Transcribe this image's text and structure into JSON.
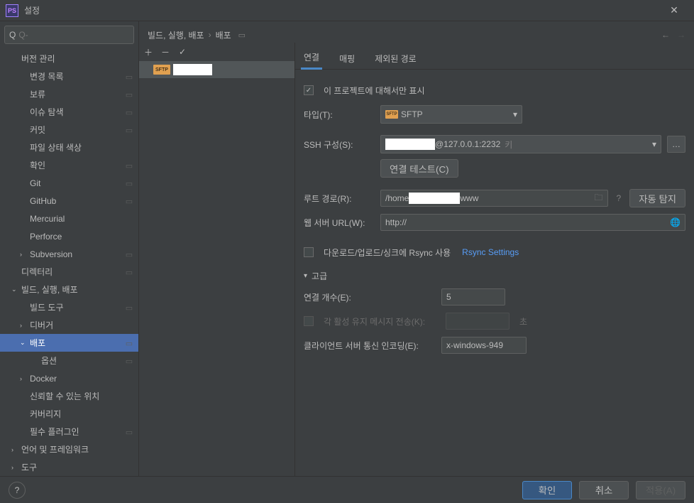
{
  "window": {
    "title": "설정",
    "logo": "PS"
  },
  "search": {
    "placeholder": "Q-"
  },
  "sidebar": {
    "items": [
      {
        "label": "버전 관리",
        "depth": 0,
        "expand": "",
        "ind": false
      },
      {
        "label": "변경 목록",
        "depth": 1,
        "expand": "",
        "ind": true
      },
      {
        "label": "보류",
        "depth": 1,
        "expand": "",
        "ind": true
      },
      {
        "label": "이슈 탐색",
        "depth": 1,
        "expand": "",
        "ind": true
      },
      {
        "label": "커밋",
        "depth": 1,
        "expand": "",
        "ind": true
      },
      {
        "label": "파일 상태 색상",
        "depth": 1,
        "expand": "",
        "ind": false
      },
      {
        "label": "확인",
        "depth": 1,
        "expand": "",
        "ind": true
      },
      {
        "label": "Git",
        "depth": 1,
        "expand": "",
        "ind": true
      },
      {
        "label": "GitHub",
        "depth": 1,
        "expand": "",
        "ind": true
      },
      {
        "label": "Mercurial",
        "depth": 1,
        "expand": "",
        "ind": false
      },
      {
        "label": "Perforce",
        "depth": 1,
        "expand": "",
        "ind": false
      },
      {
        "label": "Subversion",
        "depth": 1,
        "expand": "›",
        "ind": true
      },
      {
        "label": "디렉터리",
        "depth": 0,
        "expand": "",
        "ind": true
      },
      {
        "label": "빌드, 실행, 배포",
        "depth": 0,
        "expand": "⌄",
        "ind": false
      },
      {
        "label": "빌드 도구",
        "depth": 1,
        "expand": "",
        "ind": true
      },
      {
        "label": "디버거",
        "depth": 1,
        "expand": "›",
        "ind": false
      },
      {
        "label": "배포",
        "depth": 1,
        "expand": "⌄",
        "ind": true,
        "selected": true
      },
      {
        "label": "옵션",
        "depth": 2,
        "expand": "",
        "ind": true
      },
      {
        "label": "Docker",
        "depth": 1,
        "expand": "›",
        "ind": false
      },
      {
        "label": "신뢰할 수 있는 위치",
        "depth": 1,
        "expand": "",
        "ind": false
      },
      {
        "label": "커버리지",
        "depth": 1,
        "expand": "",
        "ind": false
      },
      {
        "label": "필수 플러그인",
        "depth": 1,
        "expand": "",
        "ind": true
      },
      {
        "label": "언어 및 프레임워크",
        "depth": 0,
        "expand": "›",
        "ind": false
      },
      {
        "label": "도구",
        "depth": 0,
        "expand": "›",
        "ind": false
      }
    ]
  },
  "breadcrumb": {
    "parts": [
      "빌드, 실행, 배포",
      "배포"
    ]
  },
  "servers": {
    "icon_label": "SFTP"
  },
  "tabs": {
    "items": [
      "연결",
      "매핑",
      "제외된 경로"
    ],
    "active": 0
  },
  "form": {
    "project_only_label": "이 프로젝트에 대해서만 표시",
    "project_only_checked": true,
    "type_label": "타입(T):",
    "type_value": "SFTP",
    "ssh_label": "SSH 구성(S):",
    "ssh_host": "@127.0.0.1:2232",
    "ssh_key_hint": "키",
    "test_conn_label": "연결 테스트(C)",
    "root_label": "루트 경로(R):",
    "root_value_prefix": "/home",
    "root_value_suffix": "www",
    "auto_detect_label": "자동 탐지",
    "web_url_label": "웹 서버 URL(W):",
    "web_url_value": "http://",
    "rsync_label": "다운로드/업로드/싱크에 Rsync 사용",
    "rsync_checked": false,
    "rsync_link": "Rsync Settings",
    "advanced_label": "고급",
    "conn_count_label": "연결 개수(E):",
    "conn_count_value": "5",
    "keepalive_label": "각 활성 유지 메시지 전송(K):",
    "keepalive_unit": "초",
    "encoding_label": "클라이언트 서버 통신 인코딩(E):",
    "encoding_value": "x-windows-949"
  },
  "footer": {
    "ok": "확인",
    "cancel": "취소",
    "apply": "적용(A)"
  }
}
